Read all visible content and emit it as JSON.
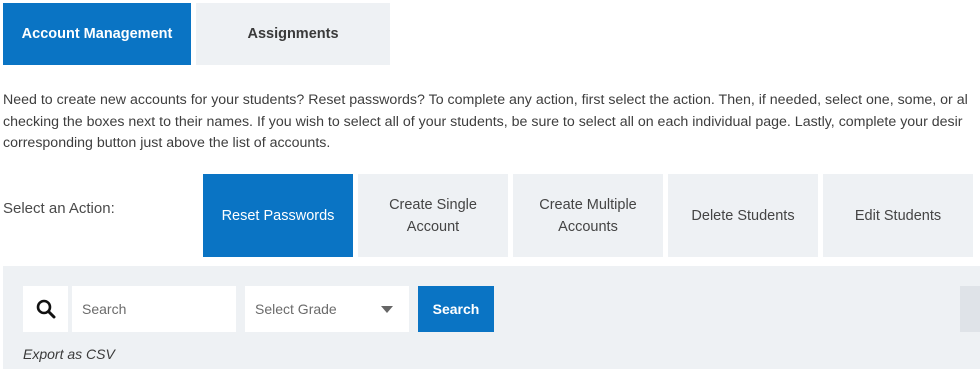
{
  "tabs": [
    {
      "label": "Account Management",
      "active": true
    },
    {
      "label": "Assignments",
      "active": false
    }
  ],
  "description": {
    "line1": "Need to create new accounts for your students? Reset passwords? To complete any action, first select the action. Then, if needed, select one, some, or al",
    "line2": "checking the boxes next to their names. If you wish to select all of your students, be sure to select all on each individual page. Lastly, complete your desir",
    "line3": "corresponding button just above the list of accounts."
  },
  "actions": {
    "label": "Select an Action:",
    "buttons": [
      {
        "label": "Reset Passwords",
        "active": true
      },
      {
        "label": "Create Single Account",
        "active": false
      },
      {
        "label": "Create Multiple Accounts",
        "active": false
      },
      {
        "label": "Delete Students",
        "active": false
      },
      {
        "label": "Edit Students",
        "active": false
      }
    ]
  },
  "search": {
    "icon": "magnifier-icon",
    "placeholder": "Search",
    "grade_placeholder": "Select Grade",
    "button_label": "Search",
    "export_label": "Export as CSV"
  },
  "colors": {
    "accent": "#0a74c4",
    "panel": "#eef1f4"
  }
}
